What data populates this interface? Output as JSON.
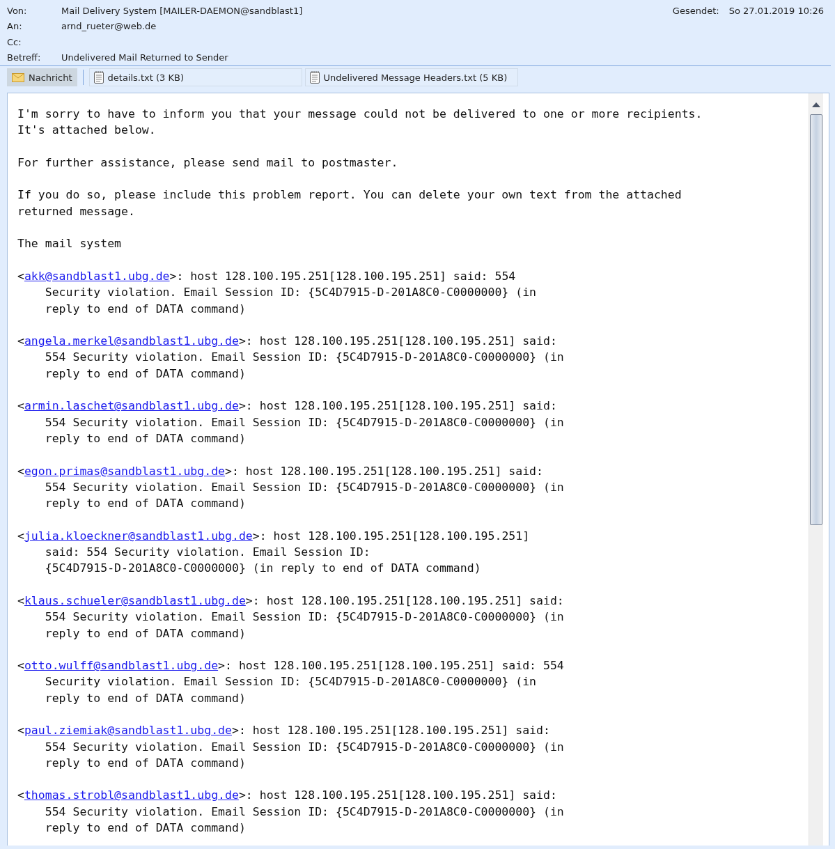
{
  "header": {
    "fields": [
      {
        "label": "Von:",
        "value": "Mail Delivery System [MAILER-DAEMON@sandblast1]"
      },
      {
        "label": "An:",
        "value": "arnd_rueter@web.de"
      },
      {
        "label": "Cc:"
      },
      {
        "label": "Betreff:",
        "value": "Undelivered Mail Returned to Sender"
      }
    ],
    "sent": {
      "label": "Gesendet:",
      "value": "So 27.01.2019 10:26"
    }
  },
  "attachments": [
    {
      "kind": "message",
      "label": "Nachricht",
      "selected": true
    },
    {
      "kind": "file",
      "label": "details.txt (3 KB)",
      "selected": false
    },
    {
      "kind": "file",
      "label": "Undelivered Message Headers.txt (5 KB)",
      "selected": false
    }
  ],
  "body": {
    "paragraphs": [
      "I'm sorry to have to inform you that your message could not be delivered to one or more recipients.\nIt's attached below.",
      "For further assistance, please send mail to postmaster.",
      "If you do so, please include this problem report. You can delete your own text from the attached\nreturned message.",
      "The mail system"
    ],
    "bounces": [
      {
        "prefix": "<",
        "address": "akk@sandblast1.ubg.de",
        "lines": [
          ">: host 128.100.195.251[128.100.195.251] said: 554",
          "Security violation. Email Session ID: {5C4D7915-D-201A8C0-C0000000} (in",
          "reply to end of DATA command)"
        ]
      },
      {
        "prefix": "<",
        "address": "angela.merkel@sandblast1.ubg.de",
        "lines": [
          ">: host 128.100.195.251[128.100.195.251] said:",
          "554 Security violation. Email Session ID: {5C4D7915-D-201A8C0-C0000000} (in",
          "reply to end of DATA command)"
        ]
      },
      {
        "prefix": "<",
        "address": "armin.laschet@sandblast1.ubg.de",
        "lines": [
          ">: host 128.100.195.251[128.100.195.251] said:",
          "554 Security violation. Email Session ID: {5C4D7915-D-201A8C0-C0000000} (in",
          "reply to end of DATA command)"
        ]
      },
      {
        "prefix": "<",
        "address": "egon.primas@sandblast1.ubg.de",
        "lines": [
          ">: host 128.100.195.251[128.100.195.251] said:",
          "554 Security violation. Email Session ID: {5C4D7915-D-201A8C0-C0000000} (in",
          "reply to end of DATA command)"
        ]
      },
      {
        "prefix": "<",
        "address": "julia.kloeckner@sandblast1.ubg.de",
        "lines": [
          ">: host 128.100.195.251[128.100.195.251]",
          "said: 554 Security violation. Email Session ID:",
          "{5C4D7915-D-201A8C0-C0000000} (in reply to end of DATA command)"
        ]
      },
      {
        "prefix": "<",
        "address": "klaus.schueler@sandblast1.ubg.de",
        "lines": [
          ">: host 128.100.195.251[128.100.195.251] said:",
          "554 Security violation. Email Session ID: {5C4D7915-D-201A8C0-C0000000} (in",
          "reply to end of DATA command)"
        ]
      },
      {
        "prefix": "<",
        "address": "otto.wulff@sandblast1.ubg.de",
        "lines": [
          ">: host 128.100.195.251[128.100.195.251] said: 554",
          "Security violation. Email Session ID: {5C4D7915-D-201A8C0-C0000000} (in",
          "reply to end of DATA command)"
        ]
      },
      {
        "prefix": "<",
        "address": "paul.ziemiak@sandblast1.ubg.de",
        "lines": [
          ">: host 128.100.195.251[128.100.195.251] said:",
          "554 Security violation. Email Session ID: {5C4D7915-D-201A8C0-C0000000} (in",
          "reply to end of DATA command)"
        ]
      },
      {
        "prefix": "<",
        "address": "thomas.strobl@sandblast1.ubg.de",
        "lines": [
          ">: host 128.100.195.251[128.100.195.251] said:",
          "554 Security violation. Email Session ID: {5C4D7915-D-201A8C0-C0000000} (in",
          "reply to end of DATA command)"
        ]
      }
    ]
  }
}
